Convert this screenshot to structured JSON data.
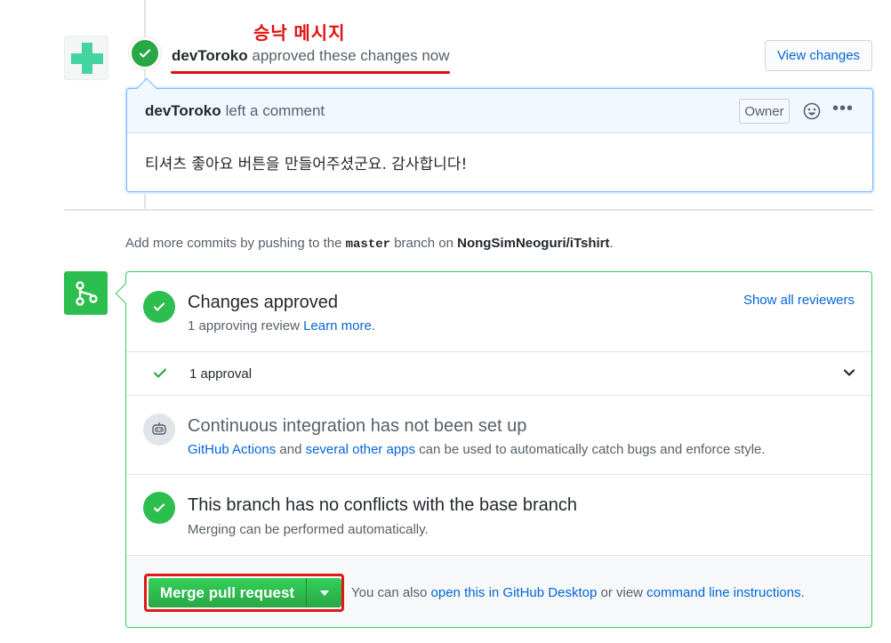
{
  "annotation": {
    "text": "승낙 메시지",
    "color": "#e01212"
  },
  "review": {
    "user": "devToroko",
    "action": "approved these changes",
    "time": "now",
    "view_changes_label": "View changes"
  },
  "comment": {
    "user": "devToroko",
    "action": "left a comment",
    "role_badge": "Owner",
    "more": "•••",
    "body": "티셔츠 좋아요 버튼을 만들어주셨군요. 감사합니다!"
  },
  "hint": {
    "prefix": "Add more commits by pushing to the",
    "branch": "master",
    "middle": "branch on",
    "repo": "NongSimNeoguri/iTshirt",
    "suffix": "."
  },
  "merge_box": {
    "approved": {
      "title": "Changes approved",
      "sub_prefix": "1 approving review",
      "learn_more": "Learn more.",
      "show_reviewers": "Show all reviewers"
    },
    "approvals": {
      "label": "1 approval"
    },
    "ci": {
      "title": "Continuous integration has not been set up",
      "link1": "GitHub Actions",
      "and": "and",
      "link2": "several other apps",
      "rest": "can be used to automatically catch bugs and enforce style."
    },
    "conflicts": {
      "title": "This branch has no conflicts with the base branch",
      "sub": "Merging can be performed automatically."
    },
    "footer": {
      "merge_label": "Merge pull request",
      "prefix": "You can also",
      "link1": "open this in GitHub Desktop",
      "middle": "or view",
      "link2": "command line instructions",
      "suffix": "."
    }
  },
  "colors": {
    "success": "#2cbe4e",
    "link": "#0366d6",
    "highlight_red": "#e01818"
  }
}
